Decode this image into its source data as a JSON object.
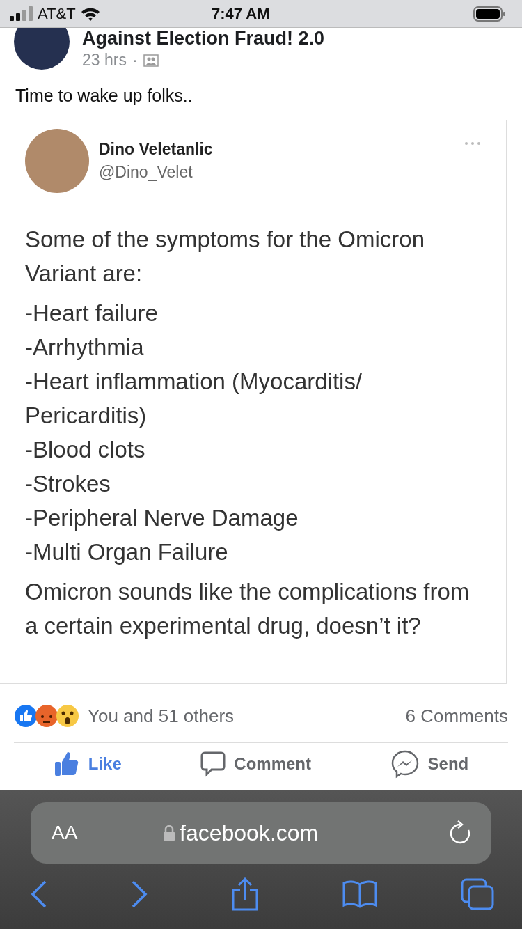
{
  "status_bar": {
    "carrier": "AT&T",
    "time": "7:47 AM"
  },
  "post": {
    "author": "Against Election Fraud! 2.0",
    "time": "23 hrs",
    "separator": "·",
    "caption": "Time to wake up folks..",
    "tweet": {
      "name": "Dino Veletanlic",
      "handle": "@Dino_Velet",
      "intro": "Some of the symptoms for the Omicron Variant are:",
      "lines": [
        "-Heart failure",
        "-Arrhythmia",
        "-Heart inflammation (Myocarditis/",
        "Pericarditis)",
        "-Blood clots",
        "-Strokes",
        "-Peripheral Nerve Damage",
        "-Multi Organ Failure"
      ],
      "closing": "Omicron sounds like the complications from a certain experimental drug, doesn’t it?"
    },
    "reactions": {
      "summary": "You and 51 others",
      "comments": "6 Comments"
    },
    "actions": [
      {
        "kind": "like",
        "label": "Like",
        "selected": true
      },
      {
        "kind": "comment",
        "label": "Comment",
        "selected": false
      },
      {
        "kind": "send",
        "label": "Send",
        "selected": false
      }
    ]
  },
  "browser": {
    "text_size": "AA",
    "url": "facebook.com"
  }
}
